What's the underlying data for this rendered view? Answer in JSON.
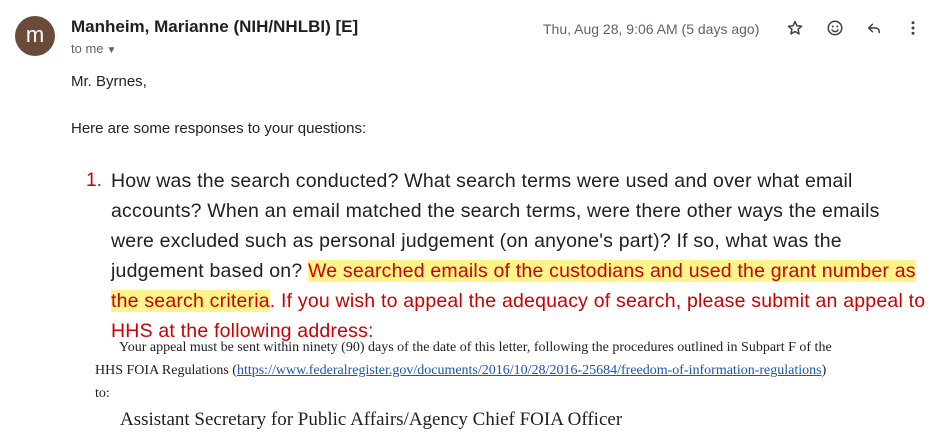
{
  "header": {
    "avatar_letter": "m",
    "sender": "Manheim, Marianne (NIH/NHLBI) [E]",
    "recipient_label": "to me",
    "timestamp": "Thu, Aug 28, 9:06 AM (5 days ago)",
    "icons": [
      "star-icon",
      "emoji-icon",
      "reply-icon",
      "more-vert-icon"
    ]
  },
  "body": {
    "greeting": "Mr. Byrnes,",
    "intro": "Here are some responses to your questions:",
    "item_number": "1.",
    "question": "How was the search conducted? What search terms were used and over what email accounts? When an email matched the search terms, were there other ways the emails were excluded such as personal judgement (on anyone's part)? If so, what was the judgement based on?",
    "answer_highlight": "We searched emails of the custodians and used the grant number as the search criteria",
    "answer_period": ".",
    "appeal_text": "If you wish to appeal the adequacy of search, please submit an appeal to HHS at the following address:",
    "letter_line1": "Your appeal must be sent within ninety (90) days of the date of this letter, following the procedures outlined in Subpart F of the",
    "letter_line2_prefix": "HHS FOIA Regulations (",
    "letter_link": "https://www.federalregister.gov/documents/2016/10/28/2016-25684/freedom-of-information-regulations",
    "letter_line2_suffix": ")",
    "letter_line3": "to:",
    "address_line": "Assistant Secretary for Public Affairs/Agency Chief FOIA Officer"
  },
  "colors": {
    "avatar_bg": "#6b4a3a",
    "answer_red": "#cc0000",
    "highlight_yellow": "#fdf58a",
    "link_blue": "#1a55b0"
  }
}
